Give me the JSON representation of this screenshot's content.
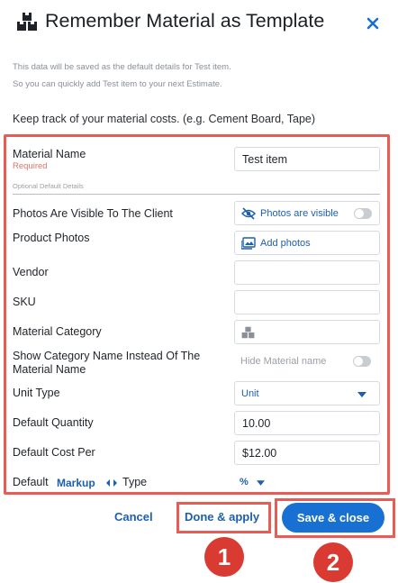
{
  "header": {
    "title": "Remember Material as Template",
    "logo_icon": "material-boxes-icon",
    "close_icon": "close-icon"
  },
  "info": {
    "line1": "This data will be saved as the default details for Test item.",
    "line2": "So you can quickly add Test item to your next Estimate."
  },
  "keep_track": "Keep track of your material costs. (e.g. Cement Board, Tape)",
  "form": {
    "material_name": {
      "label": "Material Name",
      "required": "Required",
      "value": "Test item"
    },
    "optional_heading": "Optional Default Details",
    "photos_visible": {
      "label": "Photos Are Visible To The Client",
      "button": "Photos are visible",
      "icon": "eye-slash-icon",
      "toggle_on": false
    },
    "product_photos": {
      "label": "Product Photos",
      "button": "Add photos",
      "icon": "image-icon"
    },
    "vendor": {
      "label": "Vendor",
      "value": ""
    },
    "sku": {
      "label": "SKU",
      "value": ""
    },
    "material_category": {
      "label": "Material Category",
      "icon": "material-boxes-icon"
    },
    "show_category": {
      "label_line1": "Show Category Name Instead Of The",
      "label_line2": "Material Name",
      "toggle_label": "Hide Material name",
      "toggle_on": false
    },
    "unit_type": {
      "label": "Unit Type",
      "value": "Unit",
      "icon": "caret-down-icon"
    },
    "default_quantity": {
      "label": "Default Quantity",
      "value": "10.00"
    },
    "default_cost": {
      "label": "Default Cost Per",
      "value": "$12.00"
    },
    "markup": {
      "label_prefix": "Default",
      "link": "Markup",
      "label_suffix": "Type",
      "value": "%",
      "swap_icon": "swap-arrows-icon",
      "caret_icon": "caret-down-icon"
    }
  },
  "footer": {
    "cancel": "Cancel",
    "done_apply": "Done & apply",
    "save_close": "Save & close"
  },
  "annotations": {
    "badge1": "1",
    "badge2": "2"
  },
  "colors": {
    "accent": "#1770d2",
    "link": "#1d5fae",
    "annotation": "#e85c56",
    "badge": "#d93a32"
  }
}
